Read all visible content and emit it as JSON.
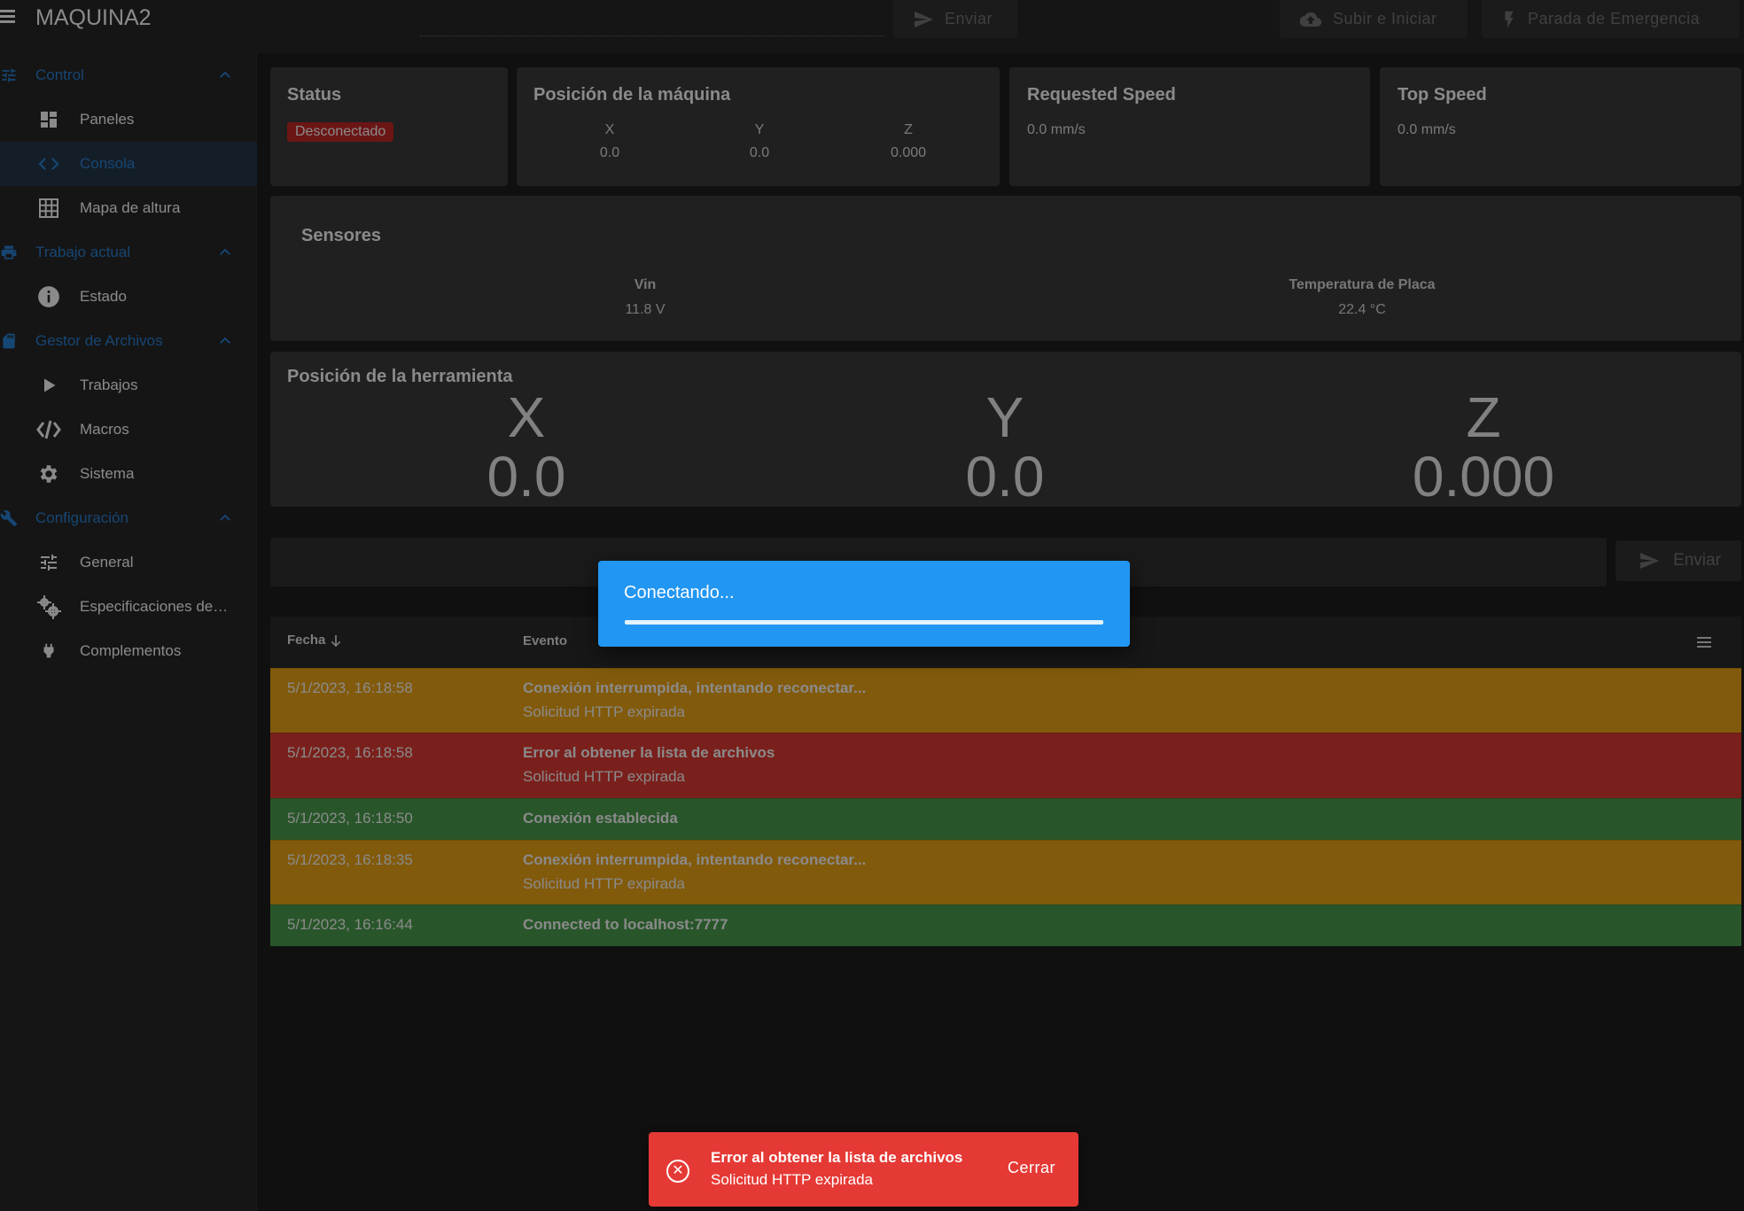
{
  "app": {
    "title": "MAQUINA2"
  },
  "toolbar": {
    "send_label": "Enviar",
    "upload_label": "Subir e Iniciar",
    "emergency_label": "Parada de Emergencia"
  },
  "sidebar": {
    "groups": [
      {
        "label": "Control",
        "icon": "sliders-icon"
      },
      {
        "label": "Trabajo actual",
        "icon": "printer-icon"
      },
      {
        "label": "Gestor de Archivos",
        "icon": "sd-card-icon"
      },
      {
        "label": "Configuración",
        "icon": "wrench-icon"
      }
    ],
    "items": [
      {
        "label": "Paneles",
        "icon": "dashboard-icon"
      },
      {
        "label": "Consola",
        "icon": "code-icon"
      },
      {
        "label": "Mapa de altura",
        "icon": "grid-icon"
      },
      {
        "label": "Estado",
        "icon": "info-icon"
      },
      {
        "label": "Trabajos",
        "icon": "play-icon"
      },
      {
        "label": "Macros",
        "icon": "macro-icon"
      },
      {
        "label": "Sistema",
        "icon": "gear-icon"
      },
      {
        "label": "General",
        "icon": "tune-icon"
      },
      {
        "label": "Especificaciones de…",
        "icon": "cogs-icon"
      },
      {
        "label": "Complementos",
        "icon": "plug-icon"
      }
    ],
    "active_item": "Consola",
    "accent_color": "#2a81d6"
  },
  "status": {
    "title": "Status",
    "badge": "Desconectado"
  },
  "machine_position": {
    "title": "Posición de la máquina",
    "axes": [
      {
        "label": "X",
        "value": "0.0"
      },
      {
        "label": "Y",
        "value": "0.0"
      },
      {
        "label": "Z",
        "value": "0.000"
      }
    ]
  },
  "requested_speed": {
    "title": "Requested Speed",
    "value": "0.0 mm/s"
  },
  "top_speed": {
    "title": "Top Speed",
    "value": "0.0 mm/s"
  },
  "sensors": {
    "title": "Sensores",
    "items": [
      {
        "label": "Vin",
        "value": "11.8 V"
      },
      {
        "label": "Temperatura de Placa",
        "value": "22.4 °C"
      }
    ]
  },
  "tool_position": {
    "title": "Posición de la herramienta",
    "axes": [
      {
        "label": "X",
        "value": "0.0"
      },
      {
        "label": "Y",
        "value": "0.0"
      },
      {
        "label": "Z",
        "value": "0.000"
      }
    ]
  },
  "console": {
    "send_label": "Enviar",
    "headers": {
      "date": "Fecha",
      "event": "Evento"
    },
    "rows": [
      {
        "date": "5/1/2023, 16:18:58",
        "title": "Conexión interrumpida, intentando reconectar...",
        "subtitle": "Solicitud HTTP expirada",
        "type": "warning"
      },
      {
        "date": "5/1/2023, 16:18:58",
        "title": "Error al obtener la lista de archivos",
        "subtitle": "Solicitud HTTP expirada",
        "type": "error"
      },
      {
        "date": "5/1/2023, 16:18:50",
        "title": "Conexión establecida",
        "subtitle": "",
        "type": "success"
      },
      {
        "date": "5/1/2023, 16:18:35",
        "title": "Conexión interrumpida, intentando reconectar...",
        "subtitle": "Solicitud HTTP expirada",
        "type": "warning"
      },
      {
        "date": "5/1/2023, 16:16:44",
        "title": "Connected to localhost:7777",
        "subtitle": "",
        "type": "success"
      }
    ],
    "colors": {
      "warning": "#f0a715",
      "error": "#e23b35",
      "success": "#4b9f4e"
    }
  },
  "dialog": {
    "text": "Conectando...",
    "color": "#2196f3"
  },
  "snackbar": {
    "title": "Error al obtener la lista de archivos",
    "subtitle": "Solicitud HTTP expirada",
    "close_label": "Cerrar",
    "color": "#e53935"
  }
}
